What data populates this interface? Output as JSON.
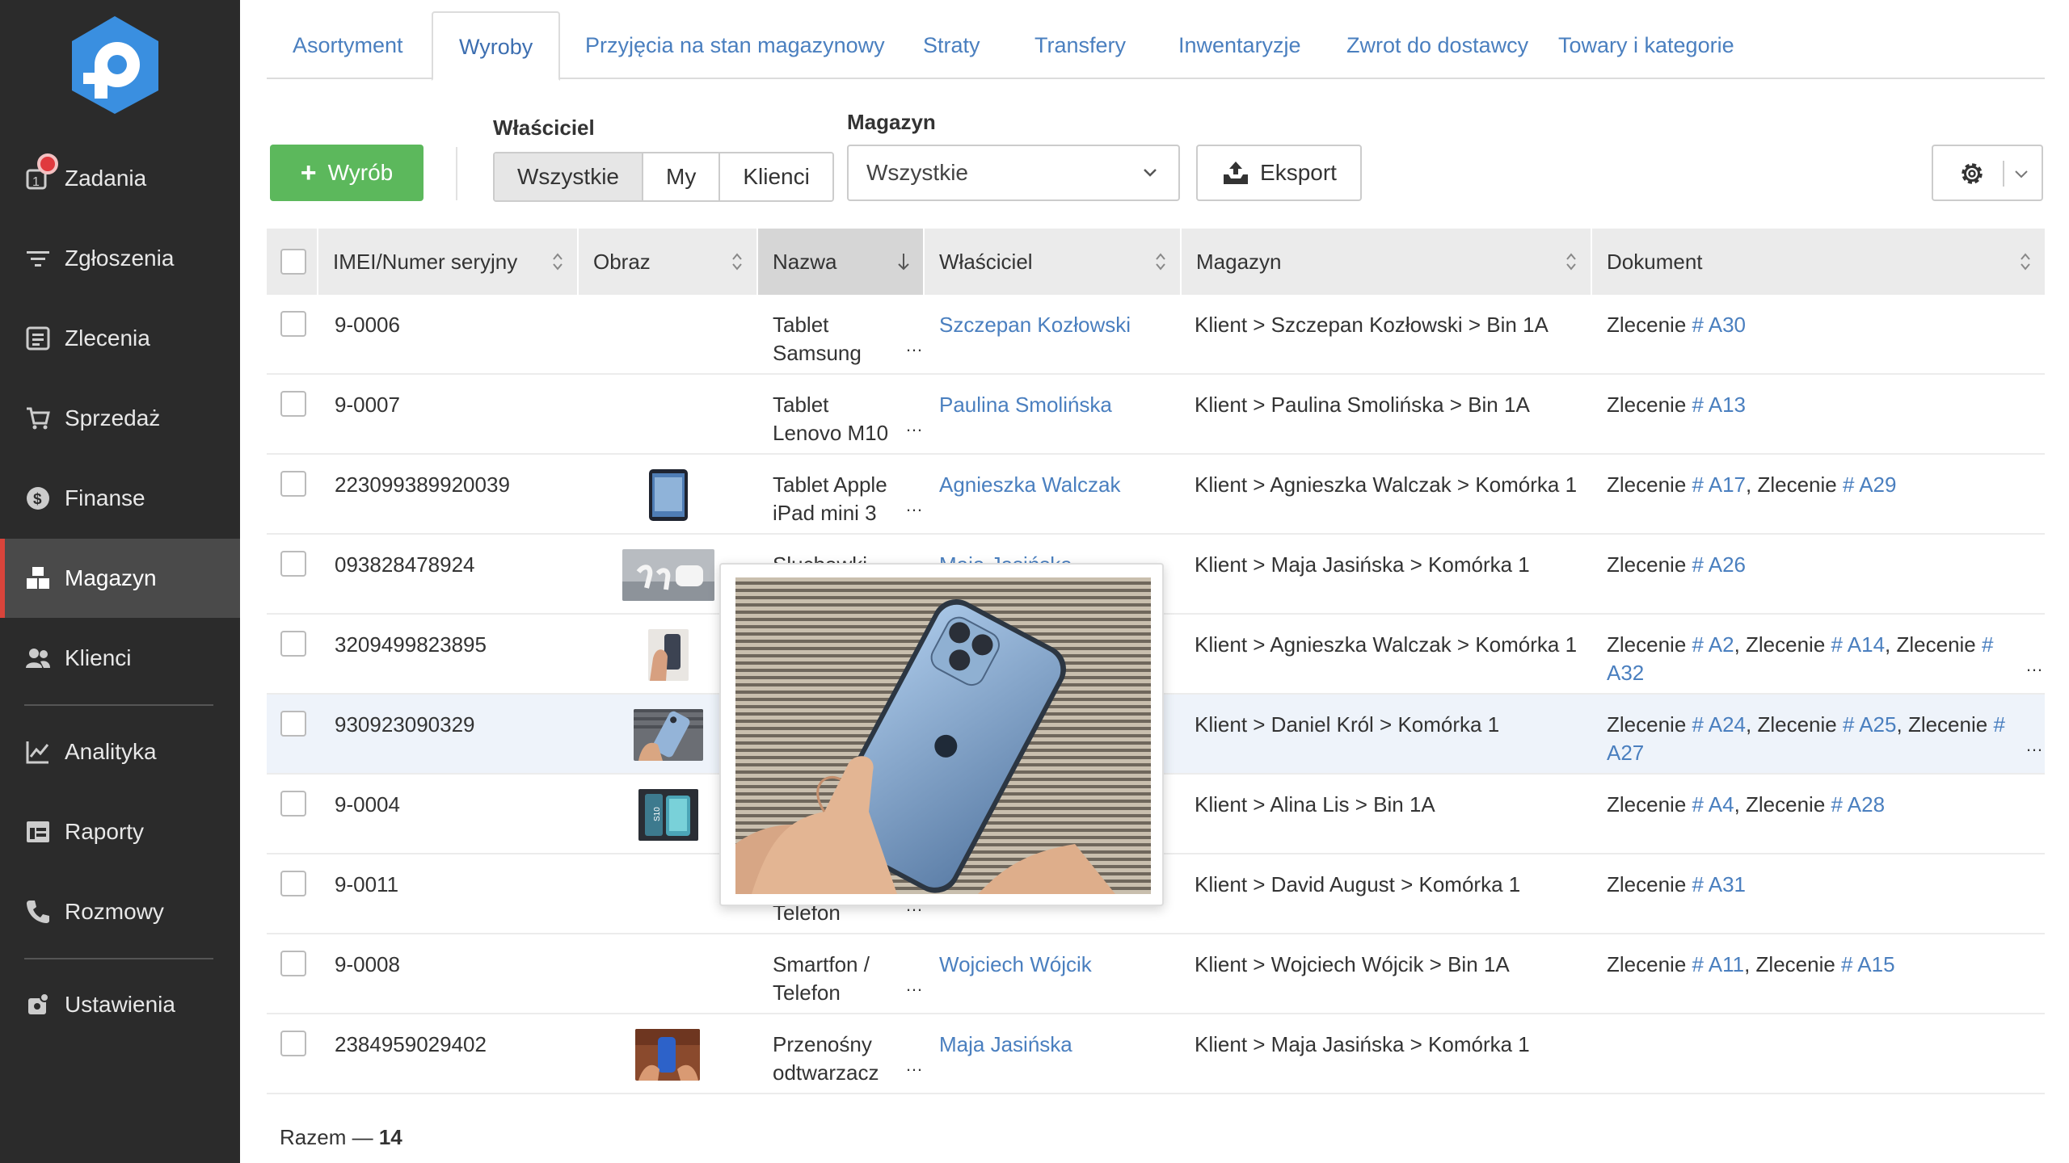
{
  "sidebar": {
    "items": [
      {
        "label": "Zadania",
        "icon": "task-icon"
      },
      {
        "label": "Zgłoszenia",
        "icon": "filter-icon"
      },
      {
        "label": "Zlecenia",
        "icon": "orders-icon"
      },
      {
        "label": "Sprzedaż",
        "icon": "cart-icon"
      },
      {
        "label": "Finanse",
        "icon": "dollar-icon"
      },
      {
        "label": "Magazyn",
        "icon": "warehouse-icon"
      },
      {
        "label": "Klienci",
        "icon": "users-icon"
      },
      {
        "label": "Analityka",
        "icon": "chart-icon"
      },
      {
        "label": "Raporty",
        "icon": "reports-icon"
      },
      {
        "label": "Rozmowy",
        "icon": "phone-icon"
      },
      {
        "label": "Ustawienia",
        "icon": "settings-icon"
      }
    ],
    "active": "Magazyn",
    "accent": "#d9443b"
  },
  "tabs": [
    "Asortyment",
    "Wyroby",
    "Przyjęcia na stan magazynowy",
    "Straty",
    "Transfery",
    "Inwentaryzje",
    "Zwrot do dostawcy",
    "Towary i kategorie"
  ],
  "toolbar": {
    "add_label": "Wyrób",
    "owner_label": "Właściciel",
    "owner_options": [
      "Wszystkie",
      "My",
      "Klienci"
    ],
    "warehouse_label": "Magazyn",
    "warehouse_value": "Wszystkie",
    "export_label": "Eksport"
  },
  "table": {
    "headers": {
      "serial": "IMEI/Numer seryjny",
      "image": "Obraz",
      "name": "Nazwa",
      "owner": "Właściciel",
      "warehouse": "Magazyn",
      "document": "Dokument"
    },
    "rows": [
      {
        "serial": "9-0006",
        "name1": "Tablet",
        "name2": "Samsung",
        "owner": "Szczepan Kozłowski",
        "warehouse": "Klient > Szczepan Kozłowski > Bin 1A",
        "docs": [
          "A30"
        ]
      },
      {
        "serial": "9-0007",
        "name1": "Tablet",
        "name2": "Lenovo M10",
        "owner": "Paulina Smolińska",
        "warehouse": "Klient > Paulina Smolińska > Bin 1A",
        "docs": [
          "A13"
        ]
      },
      {
        "serial": "223099389920039",
        "name1": "Tablet Apple",
        "name2": "iPad mini 3",
        "owner": "Agnieszka Walczak",
        "warehouse": "Klient > Agnieszka Walczak > Komórka 1",
        "docs": [
          "A17",
          "A29"
        ]
      },
      {
        "serial": "093828478924",
        "name1": "Słuchawki",
        "name2": "",
        "owner": "Maja Jasińska",
        "warehouse": "Klient > Maja Jasińska > Komórka 1",
        "docs": [
          "A26"
        ]
      },
      {
        "serial": "3209499823895",
        "name1": "",
        "name2": "",
        "owner": "",
        "warehouse": "Klient > Agnieszka Walczak > Komórka 1",
        "docs": [
          "A2",
          "A14",
          "A32"
        ]
      },
      {
        "serial": "930923090329",
        "name1": "",
        "name2": "",
        "owner": "",
        "warehouse": "Klient > Daniel Król > Komórka 1",
        "docs": [
          "A24",
          "A25",
          "A27"
        ]
      },
      {
        "serial": "9-0004",
        "name1": "",
        "name2": "",
        "owner": "",
        "warehouse": "Klient > Alina Lis > Bin 1A",
        "docs": [
          "A4",
          "A28"
        ]
      },
      {
        "serial": "9-0011",
        "name1": "",
        "name2": "Telefon",
        "owner": "",
        "warehouse": "Klient > David August > Komórka 1",
        "docs": [
          "A31"
        ]
      },
      {
        "serial": "9-0008",
        "name1": "Smartfon /",
        "name2": "Telefon",
        "owner": "Wojciech Wójcik",
        "warehouse": "Klient > Wojciech Wójcik > Bin 1A",
        "docs": [
          "A11",
          "A15"
        ]
      },
      {
        "serial": "2384959029402",
        "name1": "Przenośny",
        "name2": "odtwarzacz",
        "owner": "Maja Jasińska",
        "warehouse": "Klient > Maja Jasińska > Komórka 1",
        "docs": []
      }
    ],
    "doc_prefix": "Zlecenie",
    "hash": "#"
  },
  "footer": {
    "label": "Razem —",
    "count": "14"
  }
}
